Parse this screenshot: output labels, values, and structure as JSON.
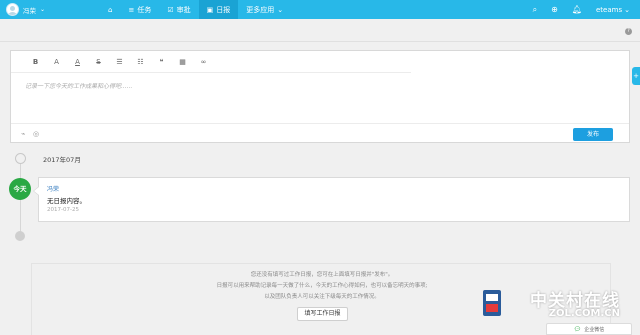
{
  "topbar": {
    "user_name": "冯荣",
    "nav": [
      {
        "label": ""
      },
      {
        "label": "任务"
      },
      {
        "label": "审批"
      },
      {
        "label": "日报"
      },
      {
        "label": "更多应用"
      }
    ],
    "brand": "eteams"
  },
  "editor": {
    "placeholder": "记录一下您今天的工作成果和心得吧......",
    "publish_label": "发布"
  },
  "timeline": {
    "month": "2017年07月",
    "today_label": "今天"
  },
  "report": {
    "author": "冯荣",
    "content": "无日报内容。",
    "date": "2017-07-25"
  },
  "notice": {
    "line1": "您还没有填写过工作日报，您可在上面填写日报并\"发布\"。",
    "line2": "日报可以用来帮助记录每一天做了什么，今天的工作心得如何，也可以备忘明天的事项;",
    "line3": "以及团队负责人可以关注下级每天的工作情况。",
    "button": "填写工作日报"
  },
  "watermark": {
    "cn": "中关村在线",
    "en": "ZOL.COM.CN",
    "wechat": "企业微信"
  },
  "colors": {
    "topbar": "#28b8e8",
    "publish": "#1d9fe0",
    "today": "#2aa844"
  }
}
